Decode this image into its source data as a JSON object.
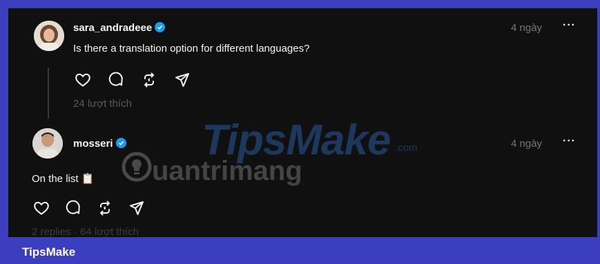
{
  "posts": [
    {
      "username": "sara_andradeee",
      "verified": true,
      "time": "4 ngày",
      "more": "···",
      "text": "Is there a translation option for different languages?",
      "likes": "24 lượt thích"
    },
    {
      "username": "mosseri",
      "verified": true,
      "time": "4 ngày",
      "more": "···",
      "text": "On the list 📋",
      "meta": "2 replies · 64 lượt thích"
    }
  ],
  "actions": [
    "heart-icon",
    "comment-icon",
    "repost-icon",
    "share-icon"
  ],
  "watermark": {
    "tips": "TipsMake",
    "com": ".com",
    "quantrimang": "uantrimang"
  },
  "brand": "TipsMake",
  "colors": {
    "frame": "#3b3fbf",
    "background": "#101010",
    "text": "#f3f5f7",
    "muted": "#777777",
    "verified": "#1d9bf0"
  }
}
